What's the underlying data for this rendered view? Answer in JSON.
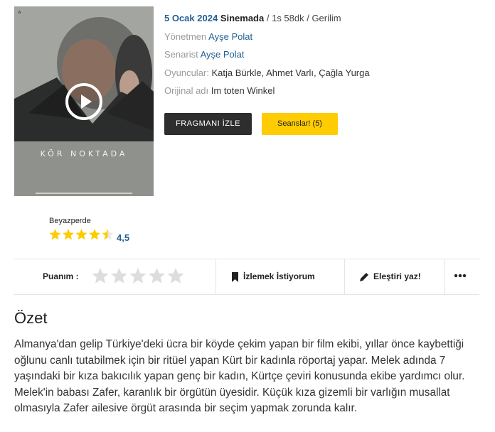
{
  "movie": {
    "poster_title": "KÖR NOKTADA",
    "release_date": "5 Ocak 2024",
    "release_type": "Sinemada",
    "duration_genre": "/ 1s 58dk / Gerilim",
    "director_label": "Yönetmen",
    "director": "Ayşe Polat",
    "writer_label": "Senarist",
    "writer": "Ayşe Polat",
    "cast_label": "Oyuncular:",
    "cast": "Katja Bürkle, Ahmet Varlı, Çağla Yurga",
    "original_label": "Orijinal adı",
    "original_title": "Im toten Winkel"
  },
  "buttons": {
    "trailer": "FRAGMANI İZLE",
    "sessions": "Seanslar! (5)"
  },
  "rating": {
    "source": "Beyazperde",
    "value": "4,5",
    "value_numeric": 4.5,
    "max": 5
  },
  "actions": {
    "my_rating_label": "Puanım :",
    "watchlist": "İzlemek İstiyorum",
    "review": "Eleştiri yaz!"
  },
  "summary": {
    "title": "Özet",
    "text": "Almanya'dan gelip Türkiye'deki ücra bir köyde çekim yapan bir film ekibi, yıllar önce kaybettiği oğlunu canlı tutabilmek için bir ritüel yapan Kürt bir kadınla röportaj yapar. Melek adında 7 yaşındaki bir kıza bakıcılık yapan genç bir kadın, Kürtçe çeviri konusunda ekibe yardımcı olur. Melek'in babası Zafer, karanlık bir örgütün üyesidir. Küçük kıza gizemli bir varlığın musallat olmasıyla Zafer ailesive örgüt arasında bir seçim yapmak zorunda kalır."
  },
  "colors": {
    "accent_blue": "#205f94",
    "star_yellow": "#fecc00",
    "dark_button": "#2e2e2e",
    "empty_star": "#dddddd"
  },
  "icons": {
    "play": "play-icon",
    "bookmark": "bookmark-icon",
    "pen": "pen-icon",
    "more": "more-dots-icon",
    "star": "star-icon"
  }
}
